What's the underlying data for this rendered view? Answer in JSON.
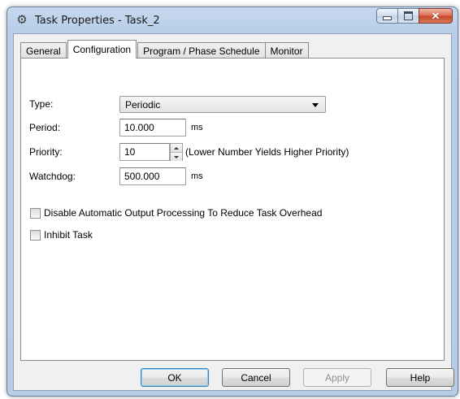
{
  "window": {
    "title": "Task Properties - Task_2",
    "icon": "task-properties-icon",
    "controls": {
      "minimize_icon": "minimize-icon",
      "maximize_icon": "maximize-icon",
      "close_icon": "close-icon",
      "close_glyph": "✕"
    }
  },
  "tabs": [
    {
      "label": "General",
      "active": false
    },
    {
      "label": "Configuration",
      "active": true
    },
    {
      "label": "Program / Phase Schedule",
      "active": false
    },
    {
      "label": "Monitor",
      "active": false
    }
  ],
  "form": {
    "type": {
      "label": "Type:",
      "value": "Periodic"
    },
    "period": {
      "label": "Period:",
      "value": "10.000",
      "unit": "ms"
    },
    "priority": {
      "label": "Priority:",
      "value": "10",
      "hint": "(Lower Number Yields Higher Priority)"
    },
    "watchdog": {
      "label": "Watchdog:",
      "value": "500.000",
      "unit": "ms"
    },
    "disable_output": {
      "label": "Disable Automatic Output Processing To Reduce Task Overhead",
      "checked": false
    },
    "inhibit": {
      "label": "Inhibit Task",
      "checked": false
    }
  },
  "buttons": {
    "ok": "OK",
    "cancel": "Cancel",
    "apply": "Apply",
    "help": "Help"
  }
}
